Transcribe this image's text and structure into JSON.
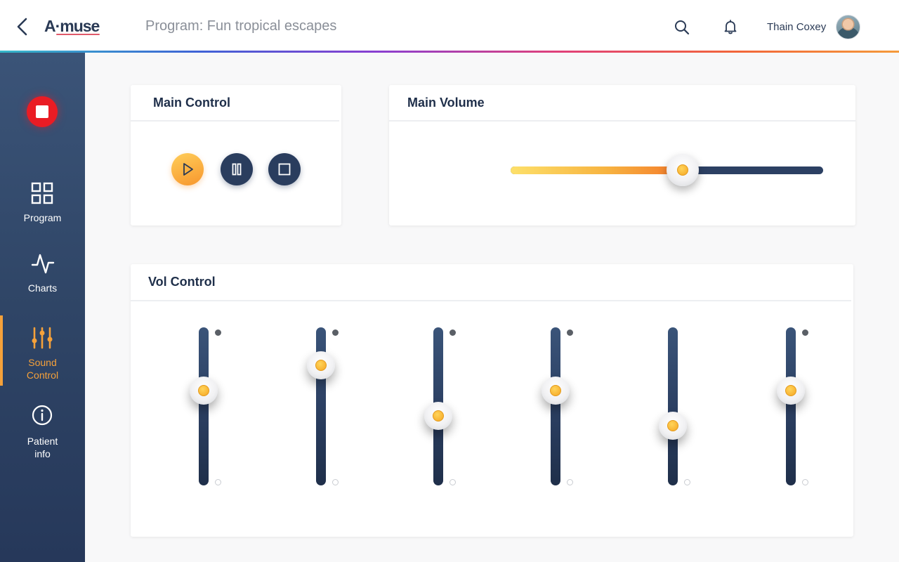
{
  "header": {
    "logo": "A·muse",
    "program_title": "Program: Fun tropical escapes",
    "user_name": "Thain Coxey",
    "icons": {
      "back": "chevron-left-icon",
      "search": "search-icon",
      "notifications": "bell-icon"
    }
  },
  "sidebar": {
    "record_button": "record-stop-icon",
    "items": [
      {
        "label": "Program",
        "icon": "grid-icon",
        "active": false
      },
      {
        "label": "Charts",
        "icon": "pulse-icon",
        "active": false
      },
      {
        "label": "Sound\nControl",
        "icon": "equalizer-icon",
        "active": true
      },
      {
        "label": "Patient\ninfo",
        "icon": "info-icon",
        "active": false
      }
    ]
  },
  "main_control": {
    "title": "Main Control",
    "buttons": [
      "play-icon",
      "pause-icon",
      "stop-icon"
    ]
  },
  "main_volume": {
    "title": "Main Volume",
    "level": 0.55
  },
  "vol_control": {
    "title": "Vol Control",
    "channels": [
      {
        "level": 0.6,
        "top_marker": true
      },
      {
        "level": 0.76,
        "top_marker": true
      },
      {
        "level": 0.44,
        "top_marker": true
      },
      {
        "level": 0.6,
        "top_marker": true
      },
      {
        "level": 0.38,
        "top_marker": false
      },
      {
        "level": 0.6,
        "top_marker": true
      }
    ]
  },
  "colors": {
    "accent": "#f5a13a",
    "sidebar": "#2f4566",
    "record": "#ea1c24",
    "track": "#2c4063"
  }
}
